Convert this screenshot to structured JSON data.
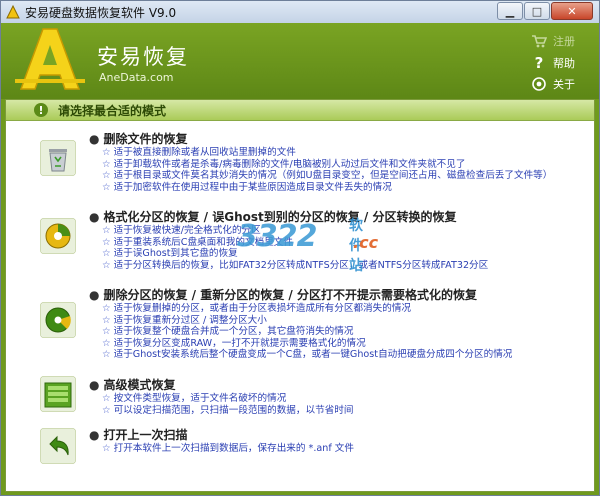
{
  "window": {
    "title": "安易硬盘数据恢复软件 V9.0"
  },
  "header": {
    "brand_cn": "安易恢复",
    "brand_en": "AneData.com",
    "menu": {
      "register": "注册",
      "help": "帮助",
      "about": "关于"
    }
  },
  "prompt": "请选择最合适的模式",
  "options": [
    {
      "title": "删除文件的恢复",
      "icon": "recycle-bin-icon",
      "lines": [
        "适于被直接删除或者从回收站里删掉的文件",
        "适于卸载软件或者是杀毒/病毒删除的文件/电脑被别人动过后文件和文件夹就不见了",
        "适于根目录或文件莫名其妙消失的情况（例如U盘目录变空，但是空间还占用、磁盘检查后丢了文件等）",
        "适于加密软件在使用过程中由于某些原因造成目录文件丢失的情况"
      ]
    },
    {
      "title": "格式化分区的恢复 / 误Ghost到别的分区的恢复 / 分区转换的恢复",
      "icon": "format-disk-icon",
      "lines": [
        "适于恢复被快速/完全格式化的分区",
        "适于重装系统后C盘桌面和我的文档里文件",
        "适于误Ghost到其它盘的恢复",
        "适于分区转换后的恢复，比如FAT32分区转成NTFS分区，或者NTFS分区转成FAT32分区"
      ]
    },
    {
      "title": "删除分区的恢复 / 重新分区的恢复 / 分区打不开提示需要格式化的恢复",
      "icon": "partition-icon",
      "lines": [
        "适于恢复删掉的分区，或者由于分区表损坏造成所有分区都消失的情况",
        "适于恢复重新分过区 / 调整分区大小",
        "适于恢复整个硬盘合并成一个分区，其它盘符消失的情况",
        "适于恢复分区变成RAW，一打不开就提示需要格式化的情况",
        "适于Ghost安装系统后整个硬盘变成一个C盘，或者一键Ghost自动把硬盘分成四个分区的情况"
      ]
    },
    {
      "title": "高级模式恢复",
      "icon": "advanced-mode-icon",
      "lines": [
        "按文件类型恢复，适于文件名破坏的情况",
        "可以设定扫描范围，只扫描一段范围的数据，以节省时间"
      ]
    },
    {
      "title": "打开上一次扫描",
      "icon": "open-last-scan-icon",
      "lines": [
        "打开本软件上一次扫描到数据后，保存出来的 *.anf 文件"
      ]
    }
  ],
  "watermark": {
    "digits": "3322",
    "cn": "软件站",
    "cc": ".cc"
  },
  "colors": {
    "header_green": "#6f9a1d",
    "bar_green": "#aacb58",
    "link_blue": "#2c40b3"
  }
}
